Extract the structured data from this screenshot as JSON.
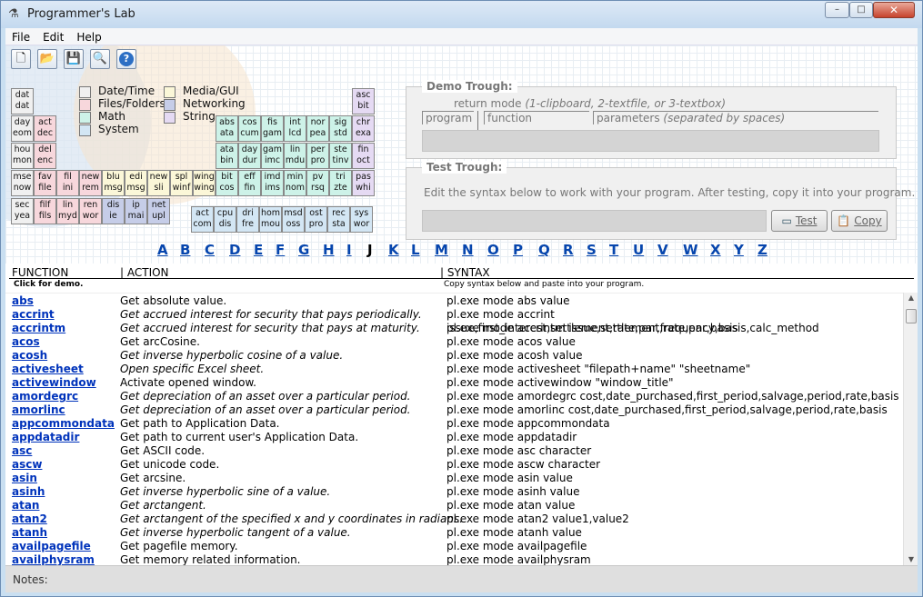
{
  "window": {
    "title": "Programmer's Lab",
    "min_glyph": "–",
    "max_glyph": "□",
    "close_glyph": "✕"
  },
  "menu": [
    "File",
    "Edit",
    "Help"
  ],
  "toolbar": [
    {
      "icon": "new-file-icon",
      "glyph": "🗋"
    },
    {
      "icon": "open-folder-icon",
      "glyph": "📂"
    },
    {
      "icon": "save-icon",
      "glyph": "💾"
    },
    {
      "icon": "search-icon",
      "glyph": "🔍"
    },
    {
      "icon": "help-icon",
      "glyph": "?"
    }
  ],
  "colors": {
    "date_time": "#f0f0f0",
    "files_folders": "#f7d7dc",
    "math": "#cdf2e8",
    "system": "#d3e6f4",
    "media_gui": "#fbf7d8",
    "networking": "#c6cde8",
    "string": "#e5daf3"
  },
  "legend": [
    {
      "label": "Date/Time",
      "cat": "date_time"
    },
    {
      "label": "Files/Folders",
      "cat": "files_folders"
    },
    {
      "label": "Math",
      "cat": "math"
    },
    {
      "label": "System",
      "cat": "system"
    },
    {
      "label": "Media/GUI",
      "cat": "media_gui"
    },
    {
      "label": "Networking",
      "cat": "networking"
    },
    {
      "label": "String",
      "cat": "string"
    }
  ],
  "periodic": [
    {
      "a": "dat",
      "b": "dat",
      "cat": "date_time"
    },
    {
      "a": "asc",
      "b": "bit",
      "cat": "string"
    },
    {
      "a": "day",
      "b": "eom",
      "cat": "date_time"
    },
    {
      "a": "act",
      "b": "dec",
      "cat": "files_folders"
    },
    {
      "a": "abs",
      "b": "ata",
      "cat": "math"
    },
    {
      "a": "cos",
      "b": "cum",
      "cat": "math"
    },
    {
      "a": "fis",
      "b": "gam",
      "cat": "math"
    },
    {
      "a": "int",
      "b": "lcd",
      "cat": "math"
    },
    {
      "a": "nor",
      "b": "pea",
      "cat": "math"
    },
    {
      "a": "sig",
      "b": "std",
      "cat": "math"
    },
    {
      "a": "chr",
      "b": "exa",
      "cat": "string"
    },
    {
      "a": "hou",
      "b": "mon",
      "cat": "date_time"
    },
    {
      "a": "del",
      "b": "enc",
      "cat": "files_folders"
    },
    {
      "a": "ata",
      "b": "bin",
      "cat": "math"
    },
    {
      "a": "day",
      "b": "dur",
      "cat": "math"
    },
    {
      "a": "gam",
      "b": "imc",
      "cat": "math"
    },
    {
      "a": "lin",
      "b": "mdu",
      "cat": "math"
    },
    {
      "a": "per",
      "b": "pro",
      "cat": "math"
    },
    {
      "a": "ste",
      "b": "tinv",
      "cat": "math"
    },
    {
      "a": "fin",
      "b": "oct",
      "cat": "string"
    },
    {
      "a": "mse",
      "b": "now",
      "cat": "date_time"
    },
    {
      "a": "fav",
      "b": "file",
      "cat": "files_folders"
    },
    {
      "a": "fil",
      "b": "ini",
      "cat": "files_folders"
    },
    {
      "a": "new",
      "b": "rem",
      "cat": "files_folders"
    },
    {
      "a": "blu",
      "b": "msg",
      "cat": "media_gui"
    },
    {
      "a": "edi",
      "b": "msg",
      "cat": "media_gui"
    },
    {
      "a": "new",
      "b": "sli",
      "cat": "media_gui"
    },
    {
      "a": "spl",
      "b": "winf",
      "cat": "media_gui"
    },
    {
      "a": "wing",
      "b": "wing",
      "cat": "media_gui"
    },
    {
      "a": "bit",
      "b": "cos",
      "cat": "math"
    },
    {
      "a": "eff",
      "b": "fin",
      "cat": "math"
    },
    {
      "a": "imd",
      "b": "ims",
      "cat": "math"
    },
    {
      "a": "min",
      "b": "nom",
      "cat": "math"
    },
    {
      "a": "pv",
      "b": "rsq",
      "cat": "math"
    },
    {
      "a": "tri",
      "b": "zte",
      "cat": "math"
    },
    {
      "a": "pas",
      "b": "whi",
      "cat": "string"
    },
    {
      "a": "sec",
      "b": "yea",
      "cat": "date_time"
    },
    {
      "a": "filf",
      "b": "fils",
      "cat": "files_folders"
    },
    {
      "a": "lin",
      "b": "myd",
      "cat": "files_folders"
    },
    {
      "a": "ren",
      "b": "wor",
      "cat": "files_folders"
    },
    {
      "a": "dis",
      "b": "ie",
      "cat": "networking"
    },
    {
      "a": "ip",
      "b": "mai",
      "cat": "networking"
    },
    {
      "a": "net",
      "b": "upl",
      "cat": "networking"
    },
    {
      "a": "act",
      "b": "com",
      "cat": "system"
    },
    {
      "a": "cpu",
      "b": "dis",
      "cat": "system"
    },
    {
      "a": "dri",
      "b": "fre",
      "cat": "system"
    },
    {
      "a": "hom",
      "b": "mou",
      "cat": "system"
    },
    {
      "a": "msd",
      "b": "oss",
      "cat": "system"
    },
    {
      "a": "ost",
      "b": "pro",
      "cat": "system"
    },
    {
      "a": "rec",
      "b": "sta",
      "cat": "system"
    },
    {
      "a": "sys",
      "b": "wor",
      "cat": "system"
    }
  ],
  "demo": {
    "title": "Demo Trough:",
    "mode_text": "return mode ",
    "mode_hint": "(1-clipboard, 2-textfile, or 3-textbox)",
    "program_lbl": "program",
    "function_lbl": "function",
    "params_lbl": "parameters ",
    "params_hint": "(separated by spaces)"
  },
  "test": {
    "title": "Test Trough:",
    "desc": "Edit the syntax below to work with your program. After testing, copy it into your program.",
    "test_btn": "Test",
    "copy_btn": "Copy"
  },
  "alphabet": [
    "A",
    "B",
    "C",
    "D",
    "E",
    "F",
    "G",
    "H",
    "I",
    "J",
    "K",
    "L",
    "M",
    "N",
    "O",
    "P",
    "Q",
    "R",
    "S",
    "T",
    "U",
    "V",
    "W",
    "X",
    "Y",
    "Z"
  ],
  "alphabet_active": "J",
  "headers": {
    "function": "FUNCTION",
    "action": "| ACTION",
    "syntax": "| SYNTAX",
    "click_hint": "Click for demo.",
    "copy_hint": "Copy syntax below and paste into your program."
  },
  "rows": [
    {
      "f": "abs",
      "a": "Get absolute value.",
      "i": false,
      "s": "pl.exe mode abs value"
    },
    {
      "f": "accrint",
      "a": "Get accrued interest for security that pays periodically.",
      "i": true,
      "s": "pl.exe mode accrint issue,first_interest,settlement,rate,par,frequency,basis,calc_method"
    },
    {
      "f": "accrintm",
      "a": "Get accrued interest for security that pays at maturity.",
      "i": true,
      "s": "pl.exe mode accrintm issue,settlement,rate,par,basis"
    },
    {
      "f": "acos",
      "a": "Get arcCosine.",
      "i": false,
      "s": "pl.exe mode acos value"
    },
    {
      "f": "acosh",
      "a": "Get inverse hyperbolic cosine of a value.",
      "i": true,
      "s": "pl.exe mode acosh value"
    },
    {
      "f": "activesheet",
      "a": "Open specific Excel sheet.",
      "i": true,
      "s": "pl.exe mode activesheet \"filepath+name\" \"sheetname\""
    },
    {
      "f": "activewindow",
      "a": "Activate opened window.",
      "i": false,
      "s": "pl.exe mode activewindow \"window_title\""
    },
    {
      "f": "amordegrc",
      "a": "Get depreciation of an asset over a particular period.",
      "i": true,
      "s": "pl.exe mode amordegrc cost,date_purchased,first_period,salvage,period,rate,basis"
    },
    {
      "f": "amorlinc",
      "a": "Get depreciation of an asset over a particular period.",
      "i": true,
      "s": "pl.exe mode amorlinc cost,date_purchased,first_period,salvage,period,rate,basis"
    },
    {
      "f": "appcommondata",
      "a": "Get path to Application Data.",
      "i": false,
      "s": "pl.exe mode appcommondata"
    },
    {
      "f": "appdatadir",
      "a": "Get path to current user's Application Data.",
      "i": false,
      "s": "pl.exe mode appdatadir"
    },
    {
      "f": "asc",
      "a": "Get ASCII code.",
      "i": false,
      "s": "pl.exe mode asc character"
    },
    {
      "f": "ascw",
      "a": "Get unicode code.",
      "i": false,
      "s": "pl.exe mode ascw character"
    },
    {
      "f": "asin",
      "a": "Get arcsine.",
      "i": false,
      "s": "pl.exe mode asin value"
    },
    {
      "f": "asinh",
      "a": "Get inverse hyperbolic sine of a value.",
      "i": true,
      "s": "pl.exe mode asinh value"
    },
    {
      "f": "atan",
      "a": "Get arctangent.",
      "i": true,
      "s": "pl.exe mode atan value"
    },
    {
      "f": "atan2",
      "a": "Get arctangent of the specified x and y coordinates in radians.",
      "i": true,
      "s": "pl.exe mode atan2 value1,value2"
    },
    {
      "f": "atanh",
      "a": "Get inverse hyperbolic tangent of a value.",
      "i": true,
      "s": "pl.exe mode atanh value"
    },
    {
      "f": "availpagefile",
      "a": "Get pagefile memory.",
      "i": false,
      "s": "pl.exe mode availpagefile"
    },
    {
      "f": "availphysram",
      "a": "Get memory related information.",
      "i": false,
      "s": "pl.exe mode availphysram"
    }
  ],
  "notes_label": "Notes:"
}
